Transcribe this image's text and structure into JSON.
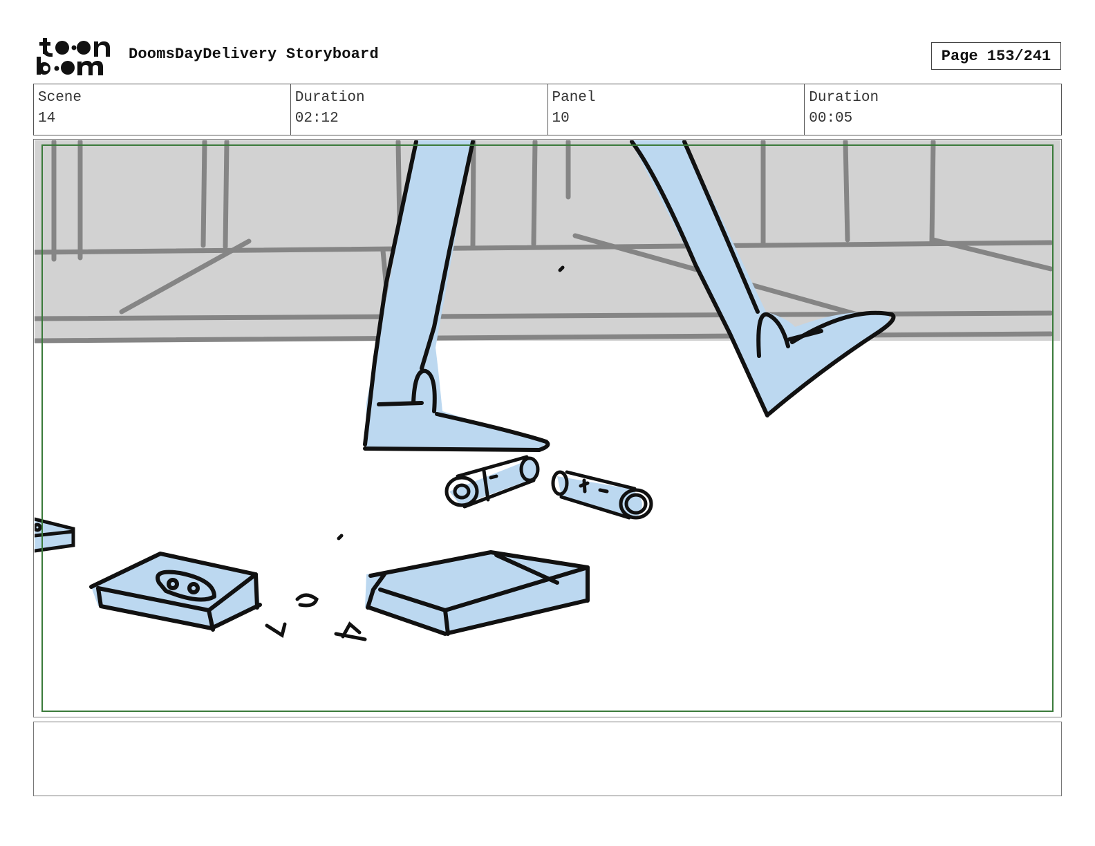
{
  "header": {
    "logo_text": "toon boom",
    "title": "DoomsDayDelivery Storyboard",
    "page_label": "Page 153/241"
  },
  "info": {
    "scene_label": "Scene",
    "scene_value": "14",
    "scene_duration_label": "Duration",
    "scene_duration_value": "02:12",
    "panel_label": "Panel",
    "panel_value": "10",
    "panel_duration_label": "Duration",
    "panel_duration_value": "00:05"
  },
  "panel": {
    "fill_color": "#bcd8f0",
    "ink_color": "#111111",
    "background_color": "#d2d2d2",
    "safe_frame_color": "#3a7a3a"
  },
  "notes": {
    "text": ""
  }
}
